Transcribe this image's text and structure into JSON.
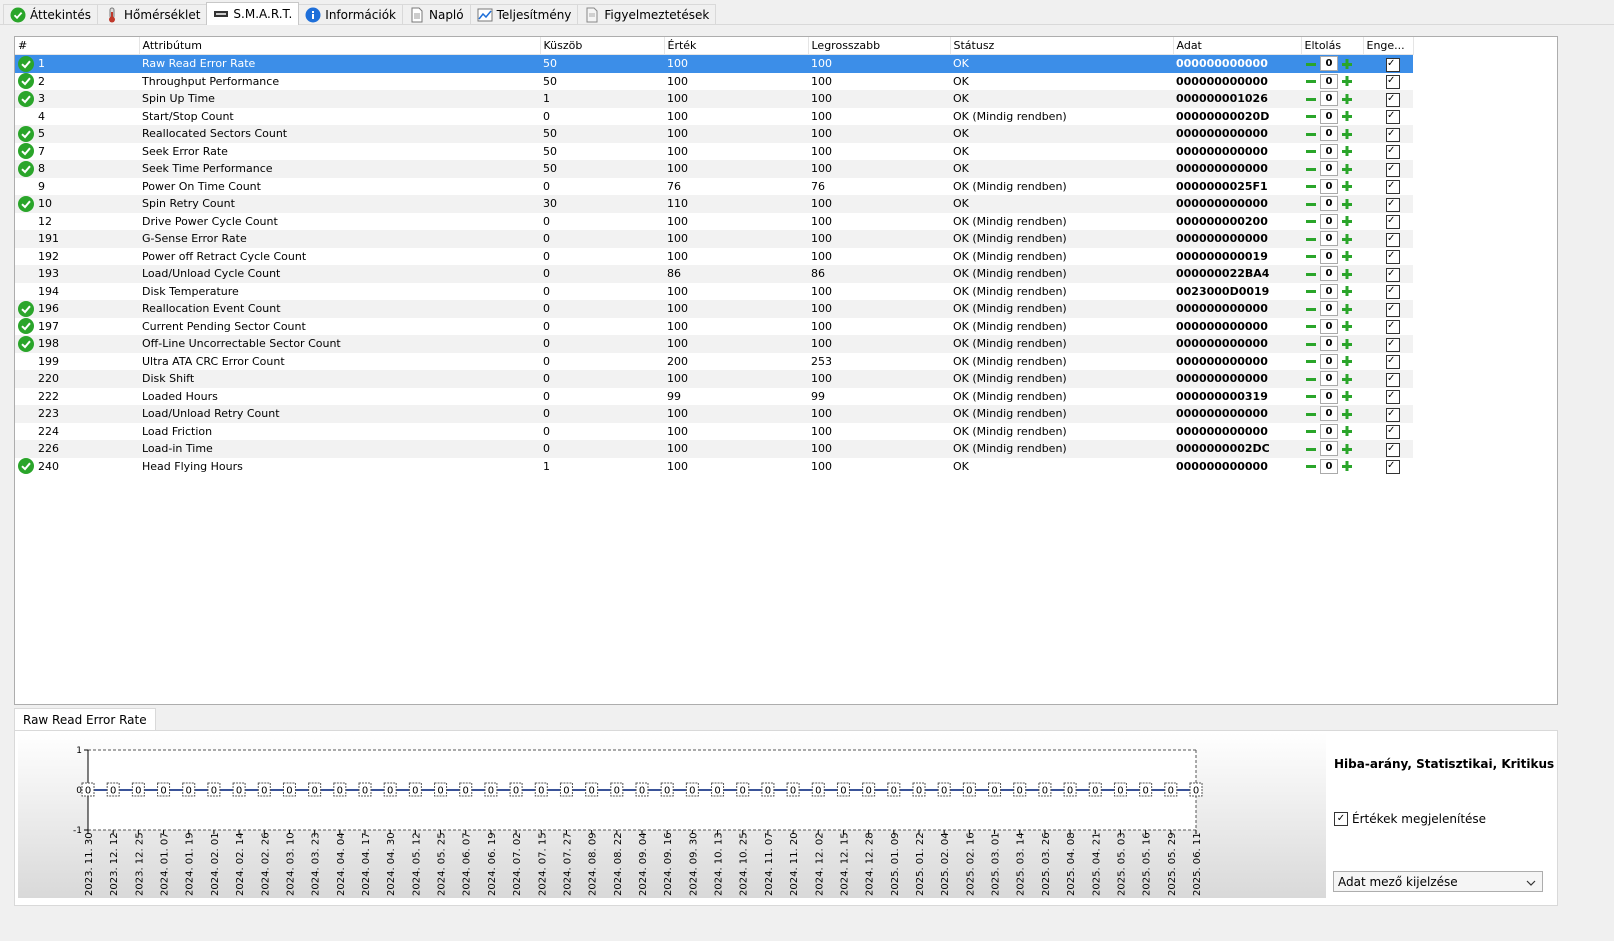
{
  "tabs": [
    {
      "label": "Áttekintés",
      "icon": "green-check-icon"
    },
    {
      "label": "Hőmérséklet",
      "icon": "thermometer-icon"
    },
    {
      "label": "S.M.A.R.T.",
      "icon": "smart-icon",
      "active": true
    },
    {
      "label": "Információk",
      "icon": "info-icon"
    },
    {
      "label": "Napló",
      "icon": "document-icon"
    },
    {
      "label": "Teljesítmény",
      "icon": "performance-chart-icon"
    },
    {
      "label": "Figyelmeztetések",
      "icon": "warning-document-icon"
    }
  ],
  "table": {
    "columns": [
      "#",
      "Attribútum",
      "Küszöb",
      "Érték",
      "Legrosszabb",
      "Státusz",
      "Adat",
      "Eltolás",
      "Enge..."
    ],
    "rows": [
      {
        "id": "1",
        "check": true,
        "attr": "Raw Read Error Rate",
        "threshold": "50",
        "value": "100",
        "worst": "100",
        "status": "OK",
        "data": "000000000000",
        "offset": "0",
        "selected": true
      },
      {
        "id": "2",
        "check": true,
        "attr": "Throughput Performance",
        "threshold": "50",
        "value": "100",
        "worst": "100",
        "status": "OK",
        "data": "000000000000",
        "offset": "0"
      },
      {
        "id": "3",
        "check": true,
        "attr": "Spin Up Time",
        "threshold": "1",
        "value": "100",
        "worst": "100",
        "status": "OK",
        "data": "000000001026",
        "offset": "0"
      },
      {
        "id": "4",
        "check": false,
        "attr": "Start/Stop Count",
        "threshold": "0",
        "value": "100",
        "worst": "100",
        "status": "OK (Mindig rendben)",
        "data": "00000000020D",
        "offset": "0"
      },
      {
        "id": "5",
        "check": true,
        "attr": "Reallocated Sectors Count",
        "threshold": "50",
        "value": "100",
        "worst": "100",
        "status": "OK",
        "data": "000000000000",
        "offset": "0"
      },
      {
        "id": "7",
        "check": true,
        "attr": "Seek Error Rate",
        "threshold": "50",
        "value": "100",
        "worst": "100",
        "status": "OK",
        "data": "000000000000",
        "offset": "0"
      },
      {
        "id": "8",
        "check": true,
        "attr": "Seek Time Performance",
        "threshold": "50",
        "value": "100",
        "worst": "100",
        "status": "OK",
        "data": "000000000000",
        "offset": "0"
      },
      {
        "id": "9",
        "check": false,
        "attr": "Power On Time Count",
        "threshold": "0",
        "value": "76",
        "worst": "76",
        "status": "OK (Mindig rendben)",
        "data": "0000000025F1",
        "offset": "0"
      },
      {
        "id": "10",
        "check": true,
        "attr": "Spin Retry Count",
        "threshold": "30",
        "value": "110",
        "worst": "100",
        "status": "OK",
        "data": "000000000000",
        "offset": "0"
      },
      {
        "id": "12",
        "check": false,
        "attr": "Drive Power Cycle Count",
        "threshold": "0",
        "value": "100",
        "worst": "100",
        "status": "OK (Mindig rendben)",
        "data": "000000000200",
        "offset": "0"
      },
      {
        "id": "191",
        "check": false,
        "attr": "G-Sense Error Rate",
        "threshold": "0",
        "value": "100",
        "worst": "100",
        "status": "OK (Mindig rendben)",
        "data": "000000000000",
        "offset": "0"
      },
      {
        "id": "192",
        "check": false,
        "attr": "Power off Retract Cycle Count",
        "threshold": "0",
        "value": "100",
        "worst": "100",
        "status": "OK (Mindig rendben)",
        "data": "000000000019",
        "offset": "0"
      },
      {
        "id": "193",
        "check": false,
        "attr": "Load/Unload Cycle Count",
        "threshold": "0",
        "value": "86",
        "worst": "86",
        "status": "OK (Mindig rendben)",
        "data": "000000022BA4",
        "offset": "0"
      },
      {
        "id": "194",
        "check": false,
        "attr": "Disk Temperature",
        "threshold": "0",
        "value": "100",
        "worst": "100",
        "status": "OK (Mindig rendben)",
        "data": "0023000D0019",
        "offset": "0"
      },
      {
        "id": "196",
        "check": true,
        "attr": "Reallocation Event Count",
        "threshold": "0",
        "value": "100",
        "worst": "100",
        "status": "OK (Mindig rendben)",
        "data": "000000000000",
        "offset": "0"
      },
      {
        "id": "197",
        "check": true,
        "attr": "Current Pending Sector Count",
        "threshold": "0",
        "value": "100",
        "worst": "100",
        "status": "OK (Mindig rendben)",
        "data": "000000000000",
        "offset": "0"
      },
      {
        "id": "198",
        "check": true,
        "attr": "Off-Line Uncorrectable Sector Count",
        "threshold": "0",
        "value": "100",
        "worst": "100",
        "status": "OK (Mindig rendben)",
        "data": "000000000000",
        "offset": "0"
      },
      {
        "id": "199",
        "check": false,
        "attr": "Ultra ATA CRC Error Count",
        "threshold": "0",
        "value": "200",
        "worst": "253",
        "status": "OK (Mindig rendben)",
        "data": "000000000000",
        "offset": "0"
      },
      {
        "id": "220",
        "check": false,
        "attr": "Disk Shift",
        "threshold": "0",
        "value": "100",
        "worst": "100",
        "status": "OK (Mindig rendben)",
        "data": "000000000000",
        "offset": "0"
      },
      {
        "id": "222",
        "check": false,
        "attr": "Loaded Hours",
        "threshold": "0",
        "value": "99",
        "worst": "99",
        "status": "OK (Mindig rendben)",
        "data": "000000000319",
        "offset": "0"
      },
      {
        "id": "223",
        "check": false,
        "attr": "Load/Unload Retry Count",
        "threshold": "0",
        "value": "100",
        "worst": "100",
        "status": "OK (Mindig rendben)",
        "data": "000000000000",
        "offset": "0"
      },
      {
        "id": "224",
        "check": false,
        "attr": "Load Friction",
        "threshold": "0",
        "value": "100",
        "worst": "100",
        "status": "OK (Mindig rendben)",
        "data": "000000000000",
        "offset": "0"
      },
      {
        "id": "226",
        "check": false,
        "attr": "Load-in Time",
        "threshold": "0",
        "value": "100",
        "worst": "100",
        "status": "OK (Mindig rendben)",
        "data": "0000000002DC",
        "offset": "0"
      },
      {
        "id": "240",
        "check": true,
        "attr": "Head Flying Hours",
        "threshold": "1",
        "value": "100",
        "worst": "100",
        "status": "OK",
        "data": "000000000000",
        "offset": "0"
      }
    ]
  },
  "bottom": {
    "tab_label": "Raw Read Error Rate",
    "info_text": "Hiba-arány, Statisztikai, Kritikus",
    "show_values_label": "Értékek megjelenítése",
    "dropdown_value": "Adat mező kijelzése"
  },
  "chart_data": {
    "type": "line",
    "title": "",
    "xlabel": "",
    "ylabel": "",
    "ylim": [
      -1,
      1
    ],
    "yticks": [
      "1",
      "0",
      "-1"
    ],
    "categories": [
      "2023. 11. 30",
      "2023. 12. 12",
      "2023. 12. 25",
      "2024. 01. 07",
      "2024. 01. 19",
      "2024. 02. 01",
      "2024. 02. 14",
      "2024. 02. 26",
      "2024. 03. 10",
      "2024. 03. 23",
      "2024. 04. 04",
      "2024. 04. 17",
      "2024. 04. 30",
      "2024. 05. 12",
      "2024. 05. 25",
      "2024. 06. 07",
      "2024. 06. 19",
      "2024. 07. 02",
      "2024. 07. 15",
      "2024. 07. 27",
      "2024. 08. 09",
      "2024. 08. 22",
      "2024. 09. 04",
      "2024. 09. 16",
      "2024. 09. 30",
      "2024. 10. 13",
      "2024. 10. 25",
      "2024. 11. 07",
      "2024. 11. 20",
      "2024. 12. 02",
      "2024. 12. 15",
      "2024. 12. 28",
      "2025. 01. 09",
      "2025. 01. 22",
      "2025. 02. 04",
      "2025. 02. 16",
      "2025. 03. 01",
      "2025. 03. 14",
      "2025. 03. 26",
      "2025. 04. 08",
      "2025. 04. 21",
      "2025. 05. 03",
      "2025. 05. 16",
      "2025. 05. 29",
      "2025. 06. 11"
    ],
    "values": [
      0,
      0,
      0,
      0,
      0,
      0,
      0,
      0,
      0,
      0,
      0,
      0,
      0,
      0,
      0,
      0,
      0,
      0,
      0,
      0,
      0,
      0,
      0,
      0,
      0,
      0,
      0,
      0,
      0,
      0,
      0,
      0,
      0,
      0,
      0,
      0,
      0,
      0,
      0,
      0,
      0,
      0,
      0,
      0,
      0
    ]
  }
}
